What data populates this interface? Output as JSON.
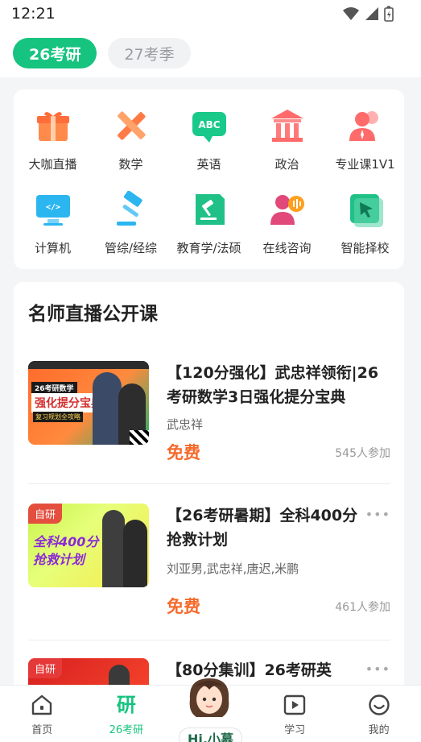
{
  "status": {
    "time": "12:21"
  },
  "top_tabs": [
    {
      "label": "26考研",
      "active": true
    },
    {
      "label": "27考季",
      "active": false
    }
  ],
  "quick_grid": [
    {
      "label": "大咖直播",
      "icon": "gift-icon"
    },
    {
      "label": "数学",
      "icon": "pencil-ruler-icon"
    },
    {
      "label": "英语",
      "icon": "abc-chat-icon"
    },
    {
      "label": "政治",
      "icon": "building-icon"
    },
    {
      "label": "专业课1V1",
      "icon": "tutor-icon"
    },
    {
      "label": "计算机",
      "icon": "monitor-code-icon"
    },
    {
      "label": "管综/经综",
      "icon": "gavel-icon"
    },
    {
      "label": "教育学/法硕",
      "icon": "law-book-icon"
    },
    {
      "label": "在线咨询",
      "icon": "consult-icon"
    },
    {
      "label": "智能择校",
      "icon": "cursor-icon"
    }
  ],
  "section": {
    "title": "名师直播公开课"
  },
  "courses": [
    {
      "title": "【120分强化】武忠祥领衔|26考研数学3日强化提分宝典",
      "author": "武忠祥",
      "price": "免费",
      "count": "545人参加",
      "thumb_text_main": "强化提分宝典",
      "thumb_text_top": "26考研数学",
      "thumb_text_sub": "复习规划全攻略",
      "badge": ""
    },
    {
      "title": "【26考研暑期】全科400分抢救计划",
      "author": "刘亚男,武忠祥,唐迟,米鹏",
      "price": "免费",
      "count": "461人参加",
      "thumb_text_main": "全科400分",
      "thumb_text_main2": "抢救计划",
      "badge": "自研"
    },
    {
      "title": "【80分集训】26考研英",
      "author": "",
      "price": "",
      "count": "",
      "badge": "自研"
    }
  ],
  "bottom_nav": [
    {
      "label": "首页",
      "active": false
    },
    {
      "label": "26考研",
      "active": true,
      "icon_text": "研"
    },
    {
      "label": "Hi,小慕",
      "active": false
    },
    {
      "label": "学习",
      "active": false
    },
    {
      "label": "我的",
      "active": false
    }
  ],
  "colors": {
    "accent": "#16c47f",
    "price": "#f56a2b"
  }
}
